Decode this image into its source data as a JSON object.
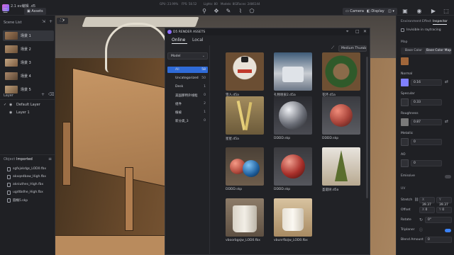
{
  "topbar": {
    "title": "2.1 ev编辑 .d5",
    "assets_label": "Assets",
    "stats": [
      "GPU: 23.99%",
      "FPS: 58.52",
      "Lights: 80",
      "Models: 802",
      "Faces: 2486144"
    ],
    "camera_label": "Camera",
    "display_label": "Display"
  },
  "scene_list": {
    "title": "Scene List",
    "items": [
      {
        "label": "场景 1",
        "selected": true
      },
      {
        "label": "场景 2"
      },
      {
        "label": "场景 3"
      },
      {
        "label": "场景 4"
      },
      {
        "label": "场景 5"
      }
    ]
  },
  "layer": {
    "title": "Layer",
    "items": [
      {
        "label": "Default Layer"
      },
      {
        "label": "Layer 1"
      }
    ]
  },
  "object": {
    "tab_object": "Object",
    "tab_imported": "Imported",
    "files": [
      "sgfxjxkdgs_LOD0.fbx",
      "akxqedbaw_High.fbx",
      "akniuthes_High.fbx",
      "ugdtbdhe_High.fbx",
      "圆桶5.skp"
    ]
  },
  "dialog": {
    "title": "D5 RENDER ASSETS",
    "tab_online": "Online",
    "tab_local": "Local",
    "dropdown": "Model",
    "size_select": "Medium Thumb",
    "categories": [
      {
        "label": "All",
        "count": "58",
        "selected": true
      },
      {
        "label": "Uncategorized",
        "count": "50"
      },
      {
        "label": "Desk",
        "count": "1"
      },
      {
        "label": "美国那特外线框",
        "count": "0"
      },
      {
        "label": "组件",
        "count": "2"
      },
      {
        "label": "植被",
        "count": "1"
      },
      {
        "label": "新分类_3",
        "count": "0"
      }
    ],
    "assets": [
      {
        "label": "雪人.d5a"
      },
      {
        "label": "礼物喷泉2.d5a"
      },
      {
        "label": "花环.d5a"
      },
      {
        "label": "星星.d5a"
      },
      {
        "label": "DDDD.skp"
      },
      {
        "label": "DDDD.skp"
      },
      {
        "label": "DDDD.skp"
      },
      {
        "label": "DDDD.skp"
      },
      {
        "label": "圣诞树.d5a"
      },
      {
        "label": "vboorbgsjw_LOD0.fbx"
      },
      {
        "label": "vbunrfbzjw_LOD0.fbx"
      }
    ]
  },
  "inspector": {
    "tabs": [
      "Environment",
      "Effect",
      "Inspector"
    ],
    "invisible_label": "Invisible in raytracing",
    "map_title": "Map",
    "base_color": "Base Color",
    "base_color_map": "Base Color Map",
    "normal_label": "Normal",
    "normal_value": "0.16",
    "specular_label": "Specular",
    "specular_value": "0.33",
    "roughness_label": "Roughness",
    "roughness_value": "0.87",
    "metallic_label": "Metallic",
    "metallic_value": "0",
    "ao_label": "AO",
    "ao_value": "0",
    "emissive_label": "Emissive",
    "uv_title": "UV",
    "stretch_label": "Stretch",
    "stretch_x": "39.37",
    "stretch_y": "39.37",
    "offset_label": "Offset",
    "offset_x": "0",
    "offset_y": "0",
    "rotate_label": "Rotate",
    "rotate_value": "0°",
    "triplanar_label": "Triplaner",
    "blend_label": "Blend Amount",
    "blend_value": "0",
    "accent": "#3b82f6"
  }
}
